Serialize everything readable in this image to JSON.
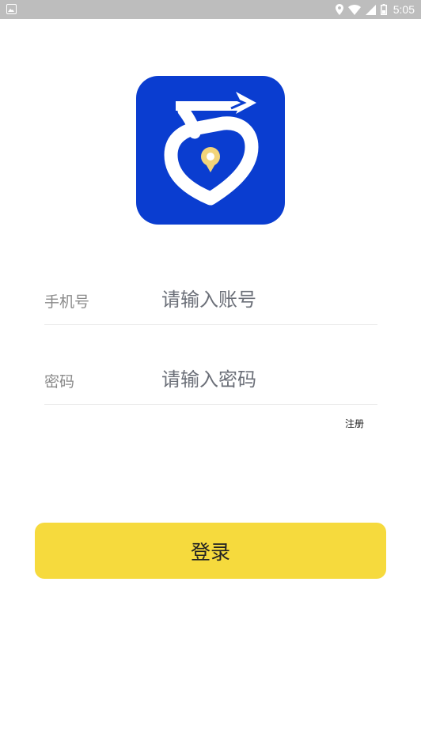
{
  "status_bar": {
    "time": "5:05",
    "icons": [
      "image-icon",
      "location-icon",
      "wifi-icon",
      "signal-icon",
      "battery-icon"
    ]
  },
  "logo": {
    "icon": "app-logo-icon",
    "background_color": "#0a3dd0"
  },
  "form": {
    "phone": {
      "label": "手机号",
      "placeholder": "请输入账号",
      "value": ""
    },
    "password": {
      "label": "密码",
      "placeholder": "请输入密码",
      "value": ""
    },
    "register_label": "注册"
  },
  "login_button": {
    "label": "登录",
    "color": "#f6da3d"
  }
}
